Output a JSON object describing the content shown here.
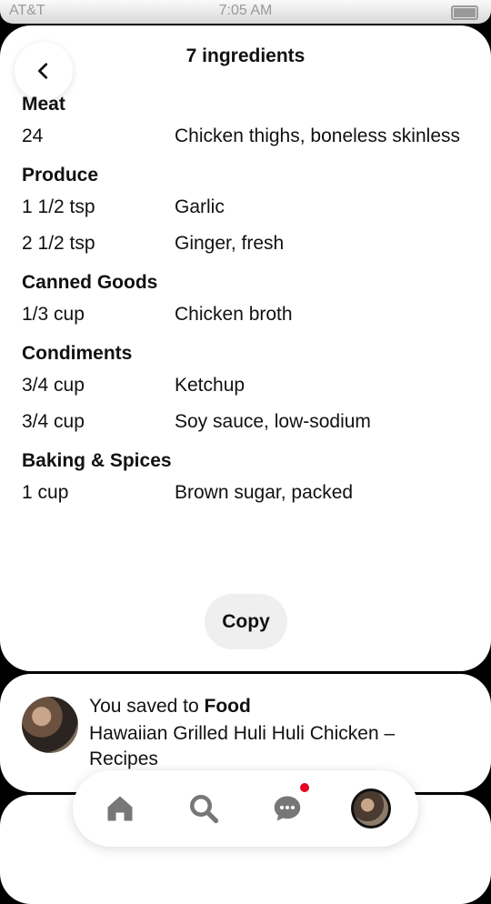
{
  "status_bar": {
    "carrier": "AT&T",
    "time": "7:05 AM"
  },
  "title": "7 ingredients",
  "sections": [
    {
      "name": "Meat",
      "items": [
        {
          "qty": "24",
          "name": "Chicken thighs, boneless skinless"
        }
      ]
    },
    {
      "name": "Produce",
      "items": [
        {
          "qty": "1 1/2 tsp",
          "name": "Garlic"
        },
        {
          "qty": "2 1/2 tsp",
          "name": "Ginger, fresh"
        }
      ]
    },
    {
      "name": "Canned Goods",
      "items": [
        {
          "qty": "1/3 cup",
          "name": "Chicken broth"
        }
      ]
    },
    {
      "name": "Condiments",
      "items": [
        {
          "qty": "3/4 cup",
          "name": "Ketchup"
        },
        {
          "qty": "3/4 cup",
          "name": "Soy sauce, low-sodium"
        }
      ]
    },
    {
      "name": "Baking & Spices",
      "items": [
        {
          "qty": "1 cup",
          "name": "Brown sugar, packed"
        }
      ]
    }
  ],
  "copy_label": "Copy",
  "saved_card": {
    "prefix": "You saved to ",
    "board": "Food",
    "pin_title": "Hawaiian Grilled Huli Huli Chicken – Recipes"
  },
  "nav": {
    "icons": [
      "home-icon",
      "search-icon",
      "messages-icon",
      "profile-avatar"
    ],
    "notification_color": "#e60023"
  }
}
